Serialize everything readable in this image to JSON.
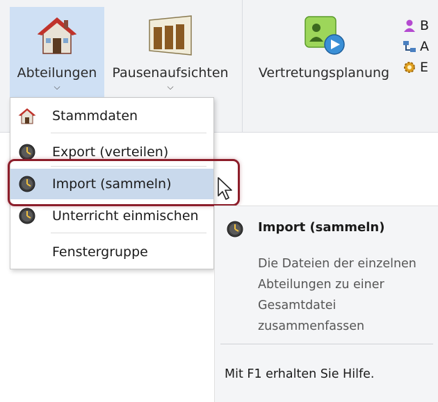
{
  "ribbon": {
    "abteilungen_label": "Abteilungen",
    "pausenaufsichten_label": "Pausenaufsichten",
    "vertretungsplanung_label": "Vertretungsplanung",
    "side_items": [
      {
        "label": "B",
        "icon": "person-icon"
      },
      {
        "label": "A",
        "icon": "network-icon"
      },
      {
        "label": "E",
        "icon": "gear-icon"
      }
    ]
  },
  "menu": {
    "items": [
      {
        "label": "Stammdaten",
        "icon": "house-icon"
      },
      {
        "label": "Export (verteilen)",
        "icon": "clock-icon"
      },
      {
        "label": "Import (sammeln)",
        "icon": "clock-icon"
      },
      {
        "label": "Unterricht einmischen",
        "icon": "clock-icon"
      },
      {
        "label": "Fenstergruppe",
        "icon": ""
      }
    ]
  },
  "tooltip": {
    "title": "Import (sammeln)",
    "description": "Die Dateien der einzelnen Abteilungen zu einer Gesamtdatei zusammenfassen",
    "help": "Mit F1 erhalten Sie Hilfe."
  },
  "colors": {
    "highlight_border": "#8c1d2a",
    "hover_bg": "#c9d9ec",
    "ribbon_selected": "#cfe0f4"
  }
}
